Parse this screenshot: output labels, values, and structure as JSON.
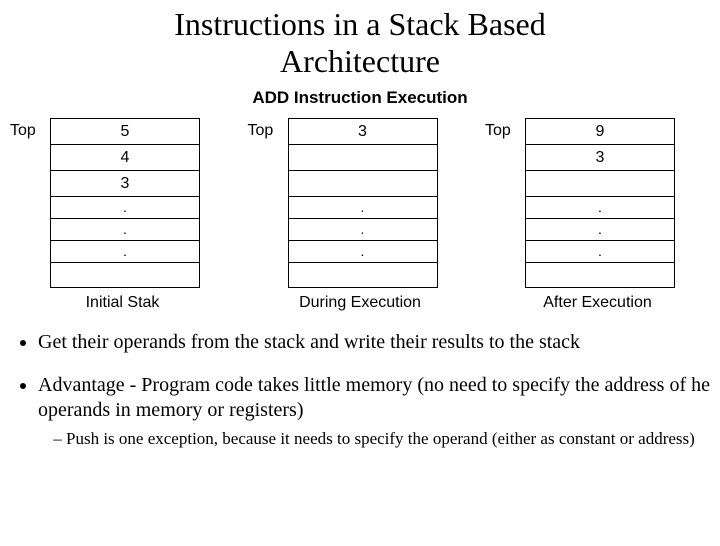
{
  "title_line1": "Instructions in a Stack Based",
  "title_line2": "Architecture",
  "diagram": {
    "heading": "ADD Instruction Execution",
    "top_label": "Top",
    "stacks": [
      {
        "caption": "Initial Stak",
        "cells": [
          "5",
          "4",
          "3",
          ".",
          ".",
          ".",
          ""
        ]
      },
      {
        "caption": "During Execution",
        "cells": [
          "3",
          "",
          "",
          ".",
          ".",
          ".",
          ""
        ]
      },
      {
        "caption": "After Execution",
        "cells": [
          "9",
          "3",
          "",
          ".",
          ".",
          ".",
          ""
        ]
      }
    ]
  },
  "bullets": {
    "b1": "Get their operands from the stack and write their results to the stack",
    "b2": "Advantage - Program code takes little memory (no need to specify the address of he operands in memory or registers)",
    "b2_sub1": "Push is one exception, because it needs to specify the operand (either as constant or address)"
  }
}
